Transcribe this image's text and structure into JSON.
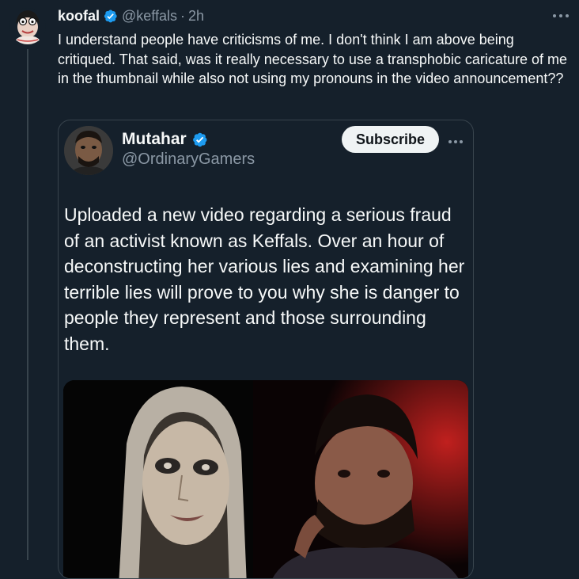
{
  "post": {
    "author_name": "koofal",
    "author_handle": "@keffals",
    "separator": "·",
    "time": "2h",
    "more_icon": "more-horizontal-icon",
    "text": "I understand people have criticisms of me. I don't think I am above being critiqued. That said, was it really necessary to use a transphobic caricature of me in the thumbnail while also not using my pronouns in the video announcement??"
  },
  "quote": {
    "author_name": "Mutahar",
    "author_handle": "@OrdinaryGamers",
    "subscribe_label": "Subscribe",
    "more_icon": "more-horizontal-icon",
    "text": "Uploaded a new video regarding a serious fraud of an activist known as Keffals. Over an hour of deconstructing her various lies and examining her terrible lies will prove to you why she is danger to people they represent and those surrounding them."
  },
  "colors": {
    "background": "#15202b",
    "verified_blue": "#1d9bf0",
    "muted_text": "#8b98a5",
    "border": "#38444d",
    "subscribe_bg": "#eff3f4"
  }
}
